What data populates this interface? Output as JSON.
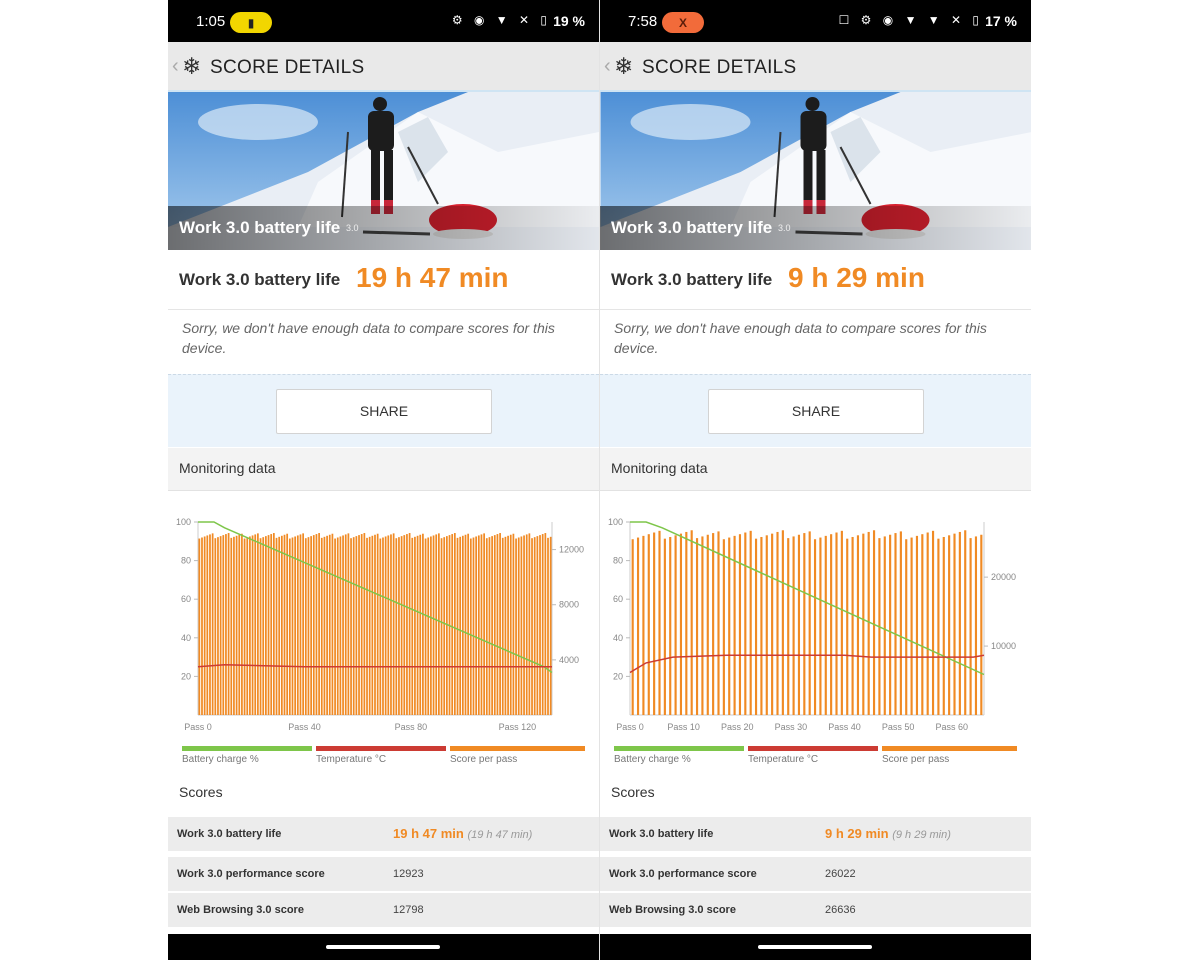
{
  "colors": {
    "accent": "#f08a24",
    "battery_line": "#7ec64a",
    "temperature_line": "#cc3b33",
    "score_bars": "#f08a24"
  },
  "phones": [
    {
      "status": {
        "time": "1:05",
        "pill_icon": "battery-saver-icon",
        "pill_symbol": "▮",
        "pill_color": "#f2d600",
        "pill_text_color": "#222",
        "icons": "⚙ ◉ ▼ ✕ ▯",
        "battery": "19 %"
      },
      "header": {
        "back_symbol": "‹",
        "title": "SCORE DETAILS"
      },
      "hero": {
        "title": "Work 3.0 battery life",
        "version": "3.0"
      },
      "result": {
        "label": "Work 3.0 battery life",
        "value": "19 h 47 min"
      },
      "compare_text": "Sorry, we don't have enough data to compare scores for this device.",
      "share_label": "SHARE",
      "monitoring_title": "Monitoring data",
      "chart_data": {
        "type": "bar",
        "x_tick_labels": [
          "Pass 0",
          "Pass 40",
          "Pass 80",
          "Pass 120"
        ],
        "x_tick_positions": [
          0,
          40,
          80,
          120
        ],
        "x_range": [
          0,
          133
        ],
        "left_axis": {
          "ticks": [
            20,
            40,
            60,
            80,
            100
          ],
          "range": [
            0,
            100
          ]
        },
        "right_axis": {
          "ticks": [
            4000,
            8000,
            12000
          ],
          "range": [
            0,
            14000
          ]
        },
        "series": [
          {
            "name": "Battery charge %",
            "type": "line",
            "axis": "left",
            "x": [
              0,
              6,
              10,
              130,
              133
            ],
            "values": [
              100,
              100,
              97,
              25,
              22
            ]
          },
          {
            "name": "Temperature °C",
            "type": "line",
            "axis": "left",
            "x": [
              0,
              10,
              40,
              133
            ],
            "values": [
              25,
              26,
              25,
              25
            ]
          },
          {
            "name": "Score per pass",
            "type": "bar",
            "axis": "right",
            "passes": 133,
            "value_min": 12800,
            "value_max": 13200
          }
        ],
        "legend": [
          "Battery charge %",
          "Temperature °C",
          "Score per pass"
        ]
      },
      "scores_title": "Scores",
      "scores": [
        {
          "name": "Work 3.0 battery life",
          "value": "19 h 47 min",
          "sub": "(19 h 47 min)"
        },
        {
          "name": "Work 3.0 performance score",
          "value": "12923",
          "sub": ""
        },
        {
          "name": "Web Browsing 3.0 score",
          "value": "12798",
          "sub": ""
        }
      ]
    },
    {
      "status": {
        "time": "7:58",
        "pill_icon": "x-icon",
        "pill_symbol": "X",
        "pill_color": "#f26b3a",
        "pill_text_color": "#5a1d0a",
        "icons": "☐ ⚙ ◉ ▼ ▼ ✕ ▯",
        "battery": "17 %"
      },
      "header": {
        "back_symbol": "‹",
        "title": "SCORE DETAILS"
      },
      "hero": {
        "title": "Work 3.0 battery life",
        "version": "3.0"
      },
      "result": {
        "label": "Work 3.0 battery life",
        "value": "9 h 29 min"
      },
      "compare_text": "Sorry, we don't have enough data to compare scores for this device.",
      "share_label": "SHARE",
      "monitoring_title": "Monitoring data",
      "chart_data": {
        "type": "bar",
        "x_tick_labels": [
          "Pass 0",
          "Pass 10",
          "Pass 20",
          "Pass 30",
          "Pass 40",
          "Pass 50",
          "Pass 60"
        ],
        "x_tick_positions": [
          0,
          10,
          20,
          30,
          40,
          50,
          60
        ],
        "x_range": [
          0,
          66
        ],
        "left_axis": {
          "ticks": [
            20,
            40,
            60,
            80,
            100
          ],
          "range": [
            0,
            100
          ]
        },
        "right_axis": {
          "ticks": [
            10000,
            20000
          ],
          "range": [
            0,
            28000
          ]
        },
        "series": [
          {
            "name": "Battery charge %",
            "type": "line",
            "axis": "left",
            "x": [
              0,
              3,
              6,
              66
            ],
            "values": [
              100,
              100,
              97,
              21
            ]
          },
          {
            "name": "Temperature °C",
            "type": "line",
            "axis": "left",
            "x": [
              0,
              3,
              8,
              18,
              40,
              45,
              64,
              66
            ],
            "values": [
              22,
              27,
              30,
              31,
              31,
              30,
              30,
              31
            ]
          },
          {
            "name": "Score per pass",
            "type": "bar",
            "axis": "right",
            "passes": 66,
            "value_min": 25500,
            "value_max": 26800
          }
        ],
        "legend": [
          "Battery charge %",
          "Temperature °C",
          "Score per pass"
        ]
      },
      "scores_title": "Scores",
      "scores": [
        {
          "name": "Work 3.0 battery life",
          "value": "9 h 29 min",
          "sub": "(9 h 29 min)"
        },
        {
          "name": "Work 3.0 performance score",
          "value": "26022",
          "sub": ""
        },
        {
          "name": "Web Browsing 3.0 score",
          "value": "26636",
          "sub": ""
        }
      ]
    }
  ]
}
